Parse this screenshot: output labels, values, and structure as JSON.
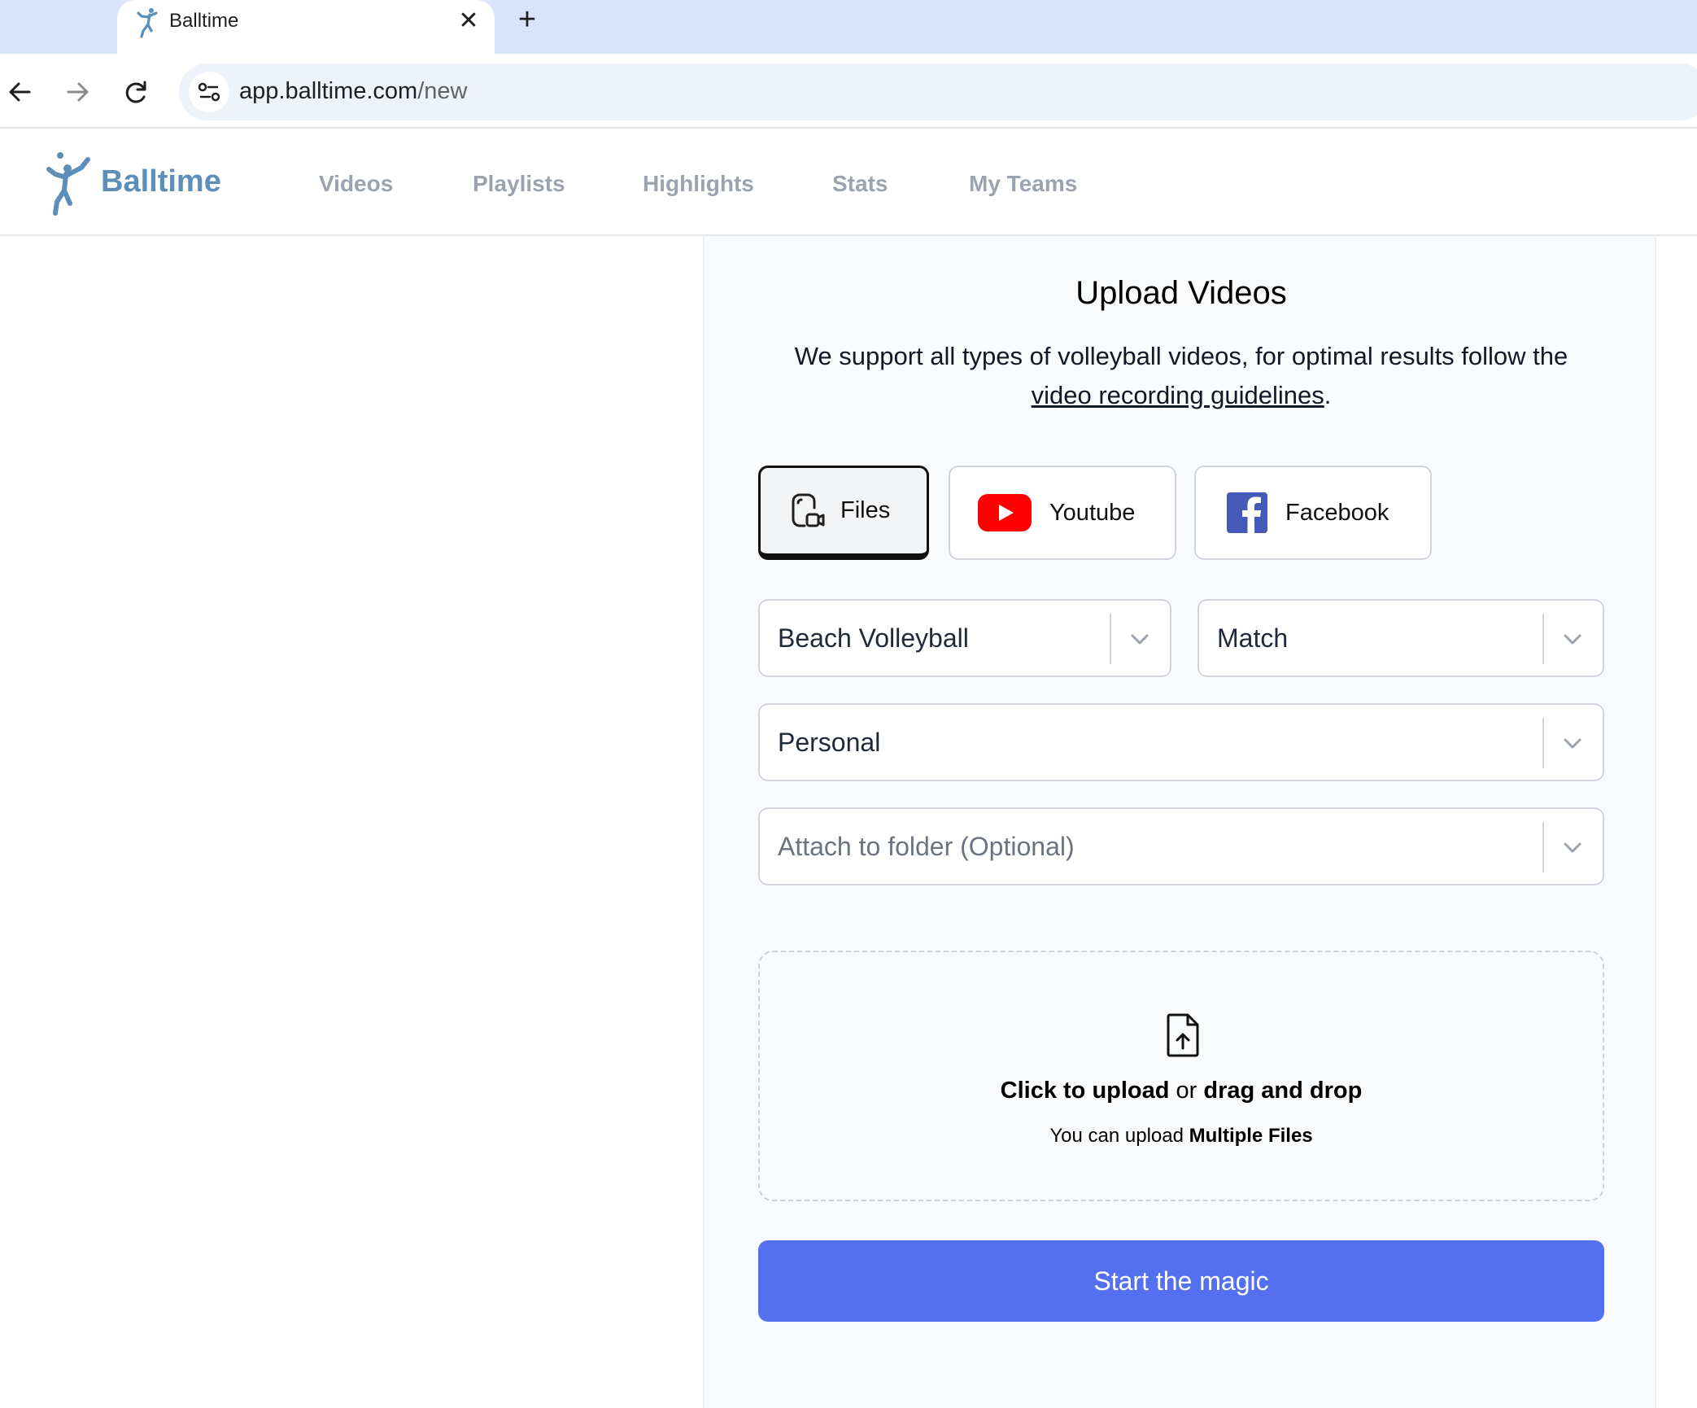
{
  "browser": {
    "tab_title": "Balltime",
    "tab_close": "✕",
    "new_tab": "+",
    "url_host": "app.balltime.com",
    "url_path": "/new"
  },
  "header": {
    "brand": "Balltime",
    "nav": [
      "Videos",
      "Playlists",
      "Highlights",
      "Stats",
      "My Teams"
    ],
    "brand_color": "#5b8fba"
  },
  "upload": {
    "title": "Upload Videos",
    "subtitle_text": "We support all types of volleyball videos, for optimal results follow the",
    "guidelines_link": "video recording guidelines",
    "subtitle_end": ".",
    "sources": [
      {
        "label": "Files",
        "icon": "file-video-icon",
        "selected": true
      },
      {
        "label": "Youtube",
        "icon": "youtube-icon",
        "selected": false
      },
      {
        "label": "Facebook",
        "icon": "facebook-icon",
        "selected": false
      }
    ],
    "sport_select": "Beach Volleyball",
    "type_select": "Match",
    "owner_select": "Personal",
    "folder_placeholder": "Attach to folder (Optional)",
    "dropzone": {
      "click_text": "Click to upload",
      "or_text": " or ",
      "drag_text": "drag and drop",
      "sub_prefix": "You can upload ",
      "sub_bold": "Multiple Files"
    },
    "start_button": "Start the magic",
    "accent_color": "#5470f1"
  }
}
